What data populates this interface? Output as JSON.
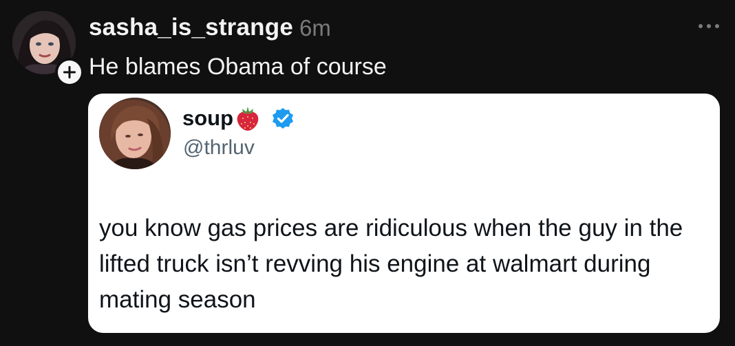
{
  "post": {
    "username": "sasha_is_strange",
    "timestamp": "6m",
    "text": "He blames Obama of course",
    "avatar": "avatar",
    "follow_icon": "plus-icon",
    "more_icon": "more-icon"
  },
  "quoted_tweet": {
    "display_name": "soup",
    "name_emoji": "strawberry-icon",
    "verified_icon": "verified-badge-icon",
    "handle": "@thrluv",
    "text": "you know gas prices are ridiculous when the guy in the lifted truck isn’t revving his engine at walmart during mating season"
  },
  "colors": {
    "background": "#101010",
    "primary_text": "#f3f3f3",
    "secondary_text": "#7a7a7a",
    "card_background": "#ffffff",
    "card_text": "#0f1419",
    "handle_text": "#536471",
    "verified_blue": "#1d9bf0"
  }
}
